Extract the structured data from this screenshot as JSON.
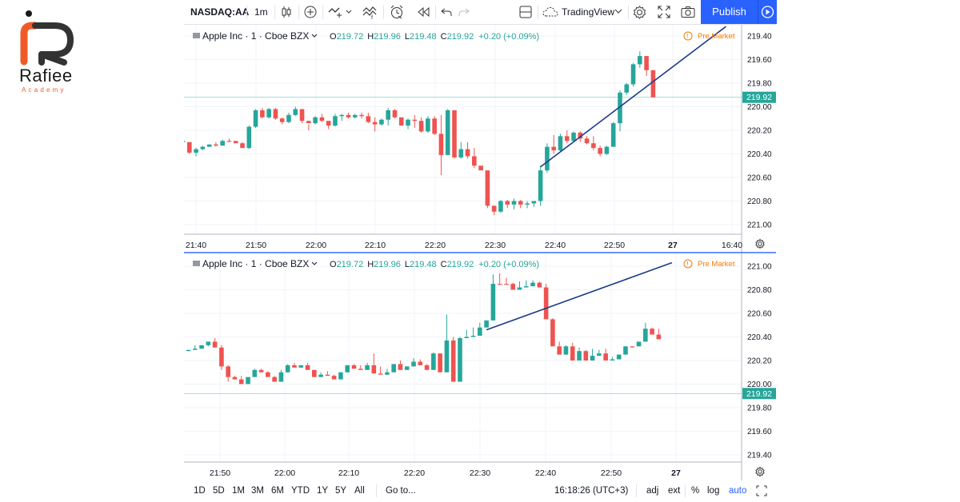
{
  "brand": {
    "name": "Rafiee",
    "sub": "Academy"
  },
  "toolbar": {
    "symbol": "NASDAQ:AA",
    "interval": "1m",
    "layout_name": "TradingView",
    "publish_label": "Publish"
  },
  "panes": [
    {
      "legend": {
        "name": "Apple Inc · 1 · Cboe BZX",
        "o_label": "O",
        "o": "219.72",
        "h_label": "H",
        "h": "219.96",
        "l_label": "L",
        "l": "219.48",
        "c_label": "C",
        "c": "219.92",
        "change": "+0.20 (+0.09%)"
      },
      "status": "Pre Market",
      "price_label": "219.92",
      "x_ticks": [
        "21:40",
        "21:50",
        "22:00",
        "22:10",
        "22:20",
        "22:30",
        "22:40",
        "22:50",
        "27",
        "16:40"
      ]
    },
    {
      "legend": {
        "name": "Apple Inc · 1 · Cboe BZX",
        "o_label": "O",
        "o": "219.72",
        "h_label": "H",
        "h": "219.96",
        "l_label": "L",
        "l": "219.48",
        "c_label": "C",
        "c": "219.92",
        "change": "+0.20 (+0.09%)"
      },
      "status": "Pre Market",
      "price_label": "219.92",
      "x_ticks": [
        "21:50",
        "22:00",
        "22:10",
        "22:20",
        "22:30",
        "22:40",
        "22:50",
        "27"
      ]
    }
  ],
  "ranges": [
    "1D",
    "5D",
    "1M",
    "3M",
    "6M",
    "YTD",
    "1Y",
    "5Y",
    "All"
  ],
  "goto_label": "Go to...",
  "clock": "16:18:26 (UTC+3)",
  "bottom_options": [
    "adj",
    "ext",
    "%",
    "log",
    "auto"
  ],
  "colors": {
    "up": "#26a69a",
    "down": "#ef5350",
    "trendline": "#1e3a8a",
    "accent": "#2962ff",
    "status": "#f57c00"
  },
  "chart_data": [
    {
      "type": "candlestick",
      "y_axis": "inverted",
      "ylim": [
        219.4,
        221.0
      ],
      "y_ticks": [
        219.4,
        219.6,
        219.8,
        220.0,
        220.2,
        220.4,
        220.6,
        220.8,
        221.0
      ],
      "last_price": 219.92,
      "candles": [
        [
          220.3,
          220.3,
          220.31,
          220.29
        ],
        [
          220.3,
          220.31,
          220.4,
          220.39
        ],
        [
          220.39,
          220.42,
          220.35,
          220.36
        ],
        [
          220.36,
          220.37,
          220.33,
          220.34
        ],
        [
          220.34,
          220.34,
          220.32,
          220.32
        ],
        [
          220.32,
          220.34,
          220.3,
          220.33
        ],
        [
          220.33,
          220.33,
          220.28,
          220.29
        ],
        [
          220.29,
          220.3,
          220.27,
          220.29
        ],
        [
          220.29,
          220.3,
          220.3,
          220.31
        ],
        [
          220.31,
          220.35,
          220.3,
          220.35
        ],
        [
          220.35,
          220.16,
          220.36,
          220.17
        ],
        [
          220.17,
          220.02,
          220.18,
          220.03
        ],
        [
          220.03,
          220.01,
          220.1,
          220.09
        ],
        [
          220.09,
          220.01,
          220.1,
          220.02
        ],
        [
          220.02,
          220.11,
          220.01,
          220.1
        ],
        [
          220.1,
          220.09,
          220.15,
          220.13
        ],
        [
          220.13,
          220.05,
          220.14,
          220.07
        ],
        [
          220.07,
          220.0,
          220.08,
          220.02
        ],
        [
          220.02,
          220.05,
          220.14,
          220.12
        ],
        [
          220.12,
          220.15,
          220.2,
          220.14
        ],
        [
          220.14,
          220.08,
          220.15,
          220.09
        ],
        [
          220.09,
          220.13,
          220.06,
          220.12
        ],
        [
          220.12,
          220.12,
          220.19,
          220.16
        ],
        [
          220.16,
          220.06,
          220.17,
          220.08
        ],
        [
          220.08,
          220.06,
          220.12,
          220.07
        ],
        [
          220.07,
          220.1,
          220.05,
          220.09
        ],
        [
          220.09,
          220.06,
          220.1,
          220.07
        ],
        [
          220.07,
          220.05,
          220.1,
          220.08
        ],
        [
          220.08,
          220.05,
          220.14,
          220.13
        ],
        [
          220.13,
          220.09,
          220.21,
          220.15
        ],
        [
          220.15,
          220.1,
          220.16,
          220.11
        ],
        [
          220.11,
          220.01,
          220.16,
          220.03
        ],
        [
          220.03,
          220.1,
          220.02,
          220.09
        ],
        [
          220.09,
          220.14,
          220.1,
          220.16
        ],
        [
          220.16,
          220.1,
          220.19,
          220.11
        ],
        [
          220.11,
          220.07,
          220.18,
          220.12
        ],
        [
          220.12,
          220.09,
          220.22,
          220.21
        ],
        [
          220.21,
          220.08,
          220.22,
          220.1
        ],
        [
          220.1,
          220.08,
          220.24,
          220.23
        ],
        [
          220.23,
          220.07,
          220.58,
          220.41
        ],
        [
          220.41,
          220.02,
          220.41,
          220.03
        ],
        [
          220.03,
          220.34,
          220.44,
          220.43
        ],
        [
          220.43,
          220.3,
          220.44,
          220.36
        ],
        [
          220.36,
          220.3,
          220.44,
          220.42
        ],
        [
          220.42,
          220.35,
          220.52,
          220.5
        ],
        [
          220.5,
          220.53,
          220.53,
          220.54
        ],
        [
          220.54,
          220.6,
          220.86,
          220.84
        ],
        [
          220.84,
          220.84,
          220.92,
          220.89
        ],
        [
          220.89,
          220.79,
          220.9,
          220.8
        ],
        [
          220.8,
          220.79,
          220.86,
          220.83
        ],
        [
          220.83,
          220.78,
          220.87,
          220.8
        ],
        [
          220.8,
          220.79,
          220.86,
          220.83
        ],
        [
          220.83,
          220.8,
          220.86,
          220.82
        ],
        [
          220.82,
          220.8,
          220.85,
          220.8
        ],
        [
          220.8,
          220.5,
          220.84,
          220.54
        ],
        [
          220.54,
          220.31,
          220.56,
          220.34
        ],
        [
          220.34,
          220.24,
          220.4,
          220.37
        ],
        [
          220.37,
          220.23,
          220.38,
          220.25
        ],
        [
          220.25,
          220.2,
          220.31,
          220.29
        ],
        [
          220.29,
          220.21,
          220.3,
          220.22
        ],
        [
          220.22,
          220.21,
          220.3,
          220.27
        ],
        [
          220.27,
          220.25,
          220.32,
          220.31
        ],
        [
          220.31,
          220.25,
          220.37,
          220.35
        ],
        [
          220.35,
          220.33,
          220.42,
          220.4
        ],
        [
          220.4,
          220.33,
          220.41,
          220.34
        ],
        [
          220.34,
          220.13,
          220.34,
          220.14
        ],
        [
          220.14,
          219.86,
          220.21,
          219.88
        ],
        [
          219.88,
          219.8,
          219.9,
          219.81
        ],
        [
          219.81,
          219.83,
          219.63,
          219.64
        ],
        [
          219.64,
          219.67,
          219.53,
          219.57
        ],
        [
          219.57,
          219.64,
          219.74,
          219.69
        ],
        [
          219.69,
          219.77,
          219.88,
          219.92
        ]
      ],
      "annotations": [
        {
          "type": "trendline",
          "from": [
            "22:31",
            220.51
          ],
          "to": [
            "22:59",
            219.32
          ]
        }
      ]
    },
    {
      "type": "candlestick",
      "ylim": [
        219.4,
        221.0
      ],
      "y_ticks": [
        219.4,
        219.6,
        219.8,
        220.0,
        220.2,
        220.4,
        220.6,
        220.8,
        221.0
      ],
      "last_price": 219.92,
      "candles": [
        [
          220.28,
          220.29,
          220.28,
          220.29
        ],
        [
          220.29,
          220.29,
          220.33,
          220.3
        ],
        [
          220.3,
          220.31,
          220.3,
          220.33
        ],
        [
          220.33,
          220.32,
          220.35,
          220.36
        ],
        [
          220.36,
          220.36,
          220.39,
          220.31
        ],
        [
          220.31,
          220.33,
          220.12,
          220.15
        ],
        [
          220.15,
          220.16,
          220.02,
          220.06
        ],
        [
          220.06,
          220.06,
          220.07,
          220.04
        ],
        [
          220.04,
          220.04,
          220.07,
          220.0
        ],
        [
          220.0,
          220.0,
          220.05,
          220.06
        ],
        [
          220.06,
          220.06,
          220.13,
          220.12
        ],
        [
          220.12,
          220.12,
          220.13,
          220.1
        ],
        [
          220.1,
          220.1,
          220.11,
          220.06
        ],
        [
          220.06,
          220.06,
          220.07,
          220.02
        ],
        [
          220.02,
          220.02,
          220.12,
          220.1
        ],
        [
          220.1,
          220.1,
          220.17,
          220.16
        ],
        [
          220.16,
          220.16,
          220.18,
          220.14
        ],
        [
          220.14,
          220.14,
          220.16,
          220.16
        ],
        [
          220.16,
          220.16,
          220.18,
          220.12
        ],
        [
          220.12,
          220.12,
          220.12,
          220.06
        ],
        [
          220.06,
          220.06,
          220.1,
          220.08
        ],
        [
          220.08,
          220.08,
          220.11,
          220.07
        ],
        [
          220.07,
          220.07,
          220.08,
          220.04
        ],
        [
          220.04,
          220.04,
          220.1,
          220.1
        ],
        [
          220.1,
          220.1,
          220.16,
          220.16
        ],
        [
          220.16,
          220.16,
          220.17,
          220.13
        ],
        [
          220.13,
          220.13,
          220.16,
          220.12
        ],
        [
          220.12,
          220.12,
          220.18,
          220.16
        ],
        [
          220.16,
          220.16,
          220.26,
          220.09
        ],
        [
          220.09,
          220.09,
          220.15,
          220.08
        ],
        [
          220.08,
          220.08,
          220.13,
          220.1
        ],
        [
          220.1,
          220.1,
          220.16,
          220.17
        ],
        [
          220.17,
          220.17,
          220.2,
          220.12
        ],
        [
          220.12,
          220.12,
          220.15,
          220.15
        ],
        [
          220.15,
          220.15,
          220.22,
          220.19
        ],
        [
          220.19,
          220.19,
          220.21,
          220.16
        ],
        [
          220.16,
          220.16,
          220.17,
          220.12
        ],
        [
          220.12,
          220.12,
          220.27,
          220.26
        ],
        [
          220.26,
          220.26,
          220.2,
          220.1
        ],
        [
          220.1,
          220.1,
          220.59,
          220.37
        ],
        [
          220.37,
          220.37,
          220.4,
          220.02
        ],
        [
          220.02,
          220.02,
          220.4,
          220.39
        ],
        [
          220.39,
          220.39,
          220.46,
          220.4
        ],
        [
          220.4,
          220.4,
          220.48,
          220.41
        ],
        [
          220.41,
          220.41,
          220.52,
          220.48
        ],
        [
          220.48,
          220.48,
          220.54,
          220.54
        ],
        [
          220.54,
          220.54,
          220.93,
          220.85
        ],
        [
          220.85,
          220.85,
          220.94,
          220.85
        ],
        [
          220.85,
          220.85,
          220.9,
          220.85
        ],
        [
          220.85,
          220.85,
          220.86,
          220.8
        ],
        [
          220.8,
          220.8,
          220.87,
          220.82
        ],
        [
          220.82,
          220.82,
          220.88,
          220.83
        ],
        [
          220.83,
          220.83,
          220.88,
          220.86
        ],
        [
          220.86,
          220.86,
          220.87,
          220.82
        ],
        [
          220.82,
          220.82,
          220.85,
          220.55
        ],
        [
          220.55,
          220.55,
          220.56,
          220.32
        ],
        [
          220.32,
          220.32,
          220.36,
          220.25
        ],
        [
          220.25,
          220.25,
          220.33,
          220.32
        ],
        [
          220.32,
          220.32,
          220.35,
          220.2
        ],
        [
          220.2,
          220.2,
          220.31,
          220.28
        ],
        [
          220.28,
          220.28,
          220.29,
          220.2
        ],
        [
          220.2,
          220.2,
          220.3,
          220.24
        ],
        [
          220.24,
          220.24,
          220.29,
          220.26
        ],
        [
          220.26,
          220.26,
          220.3,
          220.2
        ],
        [
          220.2,
          220.2,
          220.23,
          220.21
        ],
        [
          220.21,
          220.21,
          220.25,
          220.25
        ],
        [
          220.25,
          220.25,
          220.32,
          220.32
        ],
        [
          220.32,
          220.32,
          220.31,
          220.32
        ],
        [
          220.32,
          220.32,
          220.32,
          220.36
        ],
        [
          220.36,
          220.36,
          220.52,
          220.47
        ],
        [
          220.47,
          220.47,
          220.48,
          220.42
        ],
        [
          220.42,
          220.42,
          220.47,
          220.38
        ]
      ],
      "annotations": [
        {
          "type": "trendline",
          "from": [
            "22:31",
            220.46
          ],
          "to": [
            "22:59",
            221.03
          ]
        }
      ]
    }
  ]
}
